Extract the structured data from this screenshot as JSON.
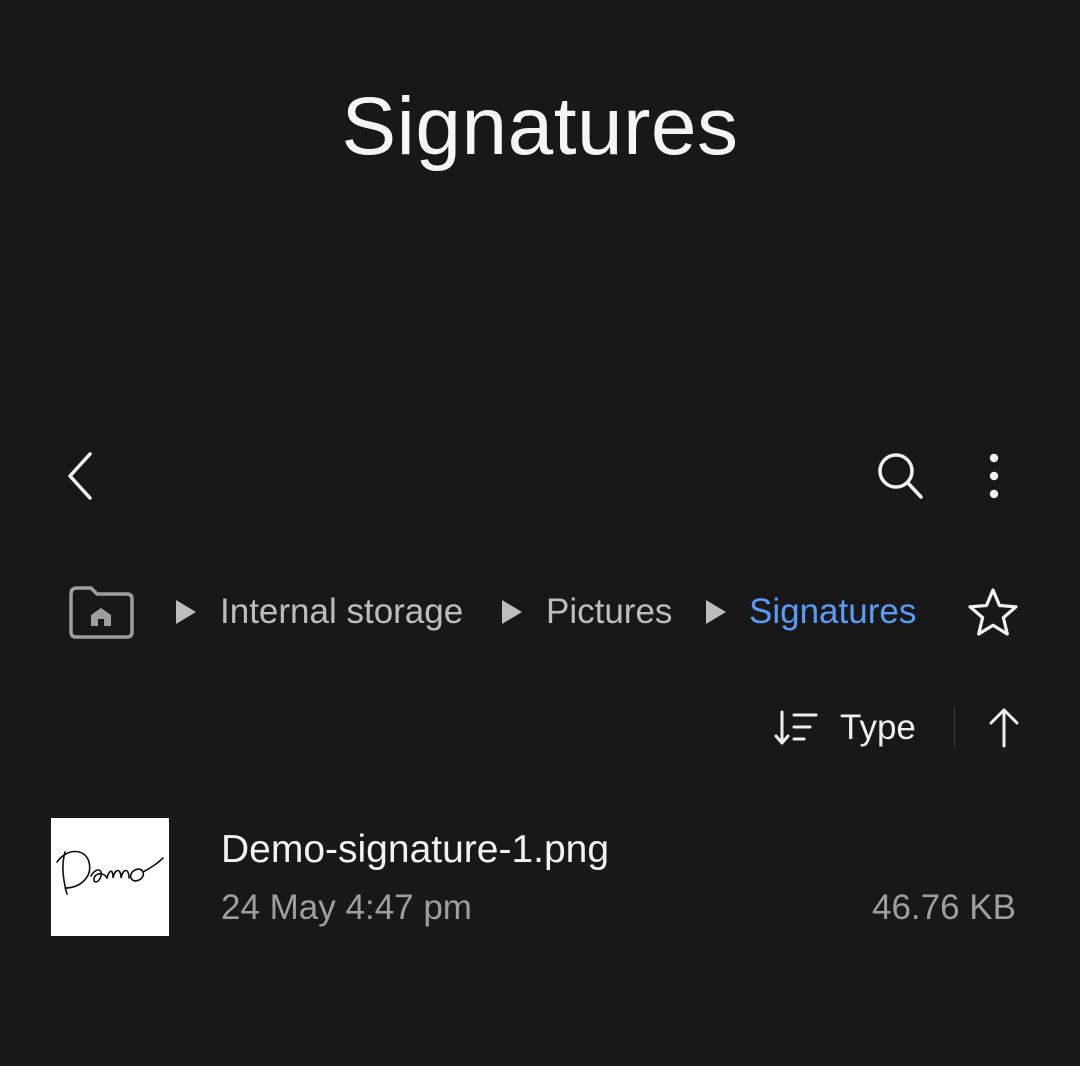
{
  "header": {
    "title": "Signatures"
  },
  "toolbar": {
    "back_icon": "chevron-left-icon",
    "search_icon": "search-icon",
    "more_icon": "more-vertical-icon"
  },
  "breadcrumb": {
    "home_icon": "home-folder-icon",
    "items": [
      {
        "label": "Internal storage"
      },
      {
        "label": "Pictures"
      },
      {
        "label": "Signatures",
        "current": true
      }
    ],
    "favorite_icon": "star-outline-icon"
  },
  "sort": {
    "label": "Type",
    "sort_icon": "sort-lines-icon",
    "direction_icon": "arrow-up-icon",
    "direction": "ascending"
  },
  "files": [
    {
      "name": "Demo-signature-1.png",
      "date": "24 May 4:47 pm",
      "size": "46.76 KB",
      "thumbnail_text": "Demo"
    }
  ],
  "colors": {
    "background": "#181818",
    "accent": "#5a9bf5",
    "text_primary": "#f2f2f2",
    "text_secondary": "#9e9e9e"
  }
}
